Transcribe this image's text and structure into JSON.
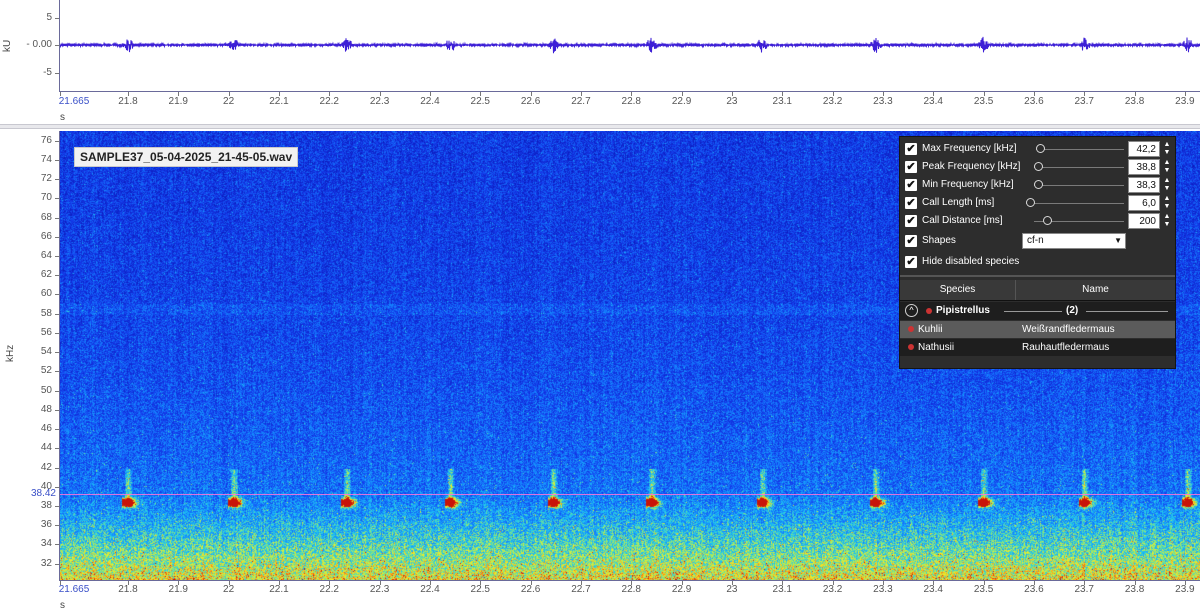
{
  "waveform": {
    "y_unit": "kU",
    "y_ticks": [
      "5",
      "- 0.00",
      "-5"
    ],
    "x_unit": "s",
    "x_ticks": [
      "21.665",
      "21.8",
      "21.9",
      "22",
      "22.1",
      "22.2",
      "22.3",
      "22.4",
      "22.5",
      "22.6",
      "22.7",
      "22.8",
      "22.9",
      "23",
      "23.1",
      "23.2",
      "23.3",
      "23.4",
      "23.5",
      "23.6",
      "23.7",
      "23.8",
      "23.9"
    ],
    "color": "#3d1fd6"
  },
  "spectrogram": {
    "file_name": "SAMPLE37_05-04-2025_21-45-05.wav",
    "y_unit": "kHz",
    "y_ticks": [
      "76",
      "74",
      "72",
      "70",
      "68",
      "66",
      "64",
      "62",
      "60",
      "58",
      "56",
      "54",
      "52",
      "50",
      "48",
      "46",
      "44",
      "42",
      "40",
      "38",
      "36",
      "34",
      "32"
    ],
    "x_unit": "s",
    "x_ticks": [
      "21.665",
      "21.8",
      "21.9",
      "22",
      "22.1",
      "22.2",
      "22.3",
      "22.4",
      "22.5",
      "22.6",
      "22.7",
      "22.8",
      "22.9",
      "23",
      "23.1",
      "23.2",
      "23.3",
      "23.4",
      "23.5",
      "23.6",
      "23.7",
      "23.8",
      "23.9"
    ],
    "cursor_value": "38.42",
    "cursor_color": "#ff73d9",
    "y_range_khz": [
      30.2,
      77.0
    ],
    "x_range_s": [
      21.665,
      23.93
    ],
    "call_times_s": [
      21.8,
      22.01,
      22.235,
      22.44,
      22.645,
      22.84,
      23.06,
      23.285,
      23.5,
      23.7,
      23.905
    ],
    "call_peak_khz": 38.4
  },
  "settings": {
    "rows": [
      {
        "label": "Max Frequency [kHz]",
        "value": "42,2",
        "checked": true
      },
      {
        "label": "Peak Frequency [kHz]",
        "value": "38,8",
        "checked": true
      },
      {
        "label": "Min Frequency [kHz]",
        "value": "38,3",
        "checked": true
      },
      {
        "label": "Call Length [ms]",
        "value": "6,0",
        "checked": true
      },
      {
        "label": "Call Distance [ms]",
        "value": "200",
        "checked": true
      }
    ],
    "shapes_label": "Shapes",
    "shapes_value": "cf-n",
    "hide_disabled_label": "Hide disabled species",
    "check_mark": "✔"
  },
  "species": {
    "col_species": "Species",
    "col_name": "Name",
    "group_name": "Pipistrellus",
    "group_count": "(2)",
    "rows": [
      {
        "species": "Kuhlii",
        "name": "Weißrandfledermaus"
      },
      {
        "species": "Nathusii",
        "name": "Rauhautfledermaus"
      }
    ]
  }
}
